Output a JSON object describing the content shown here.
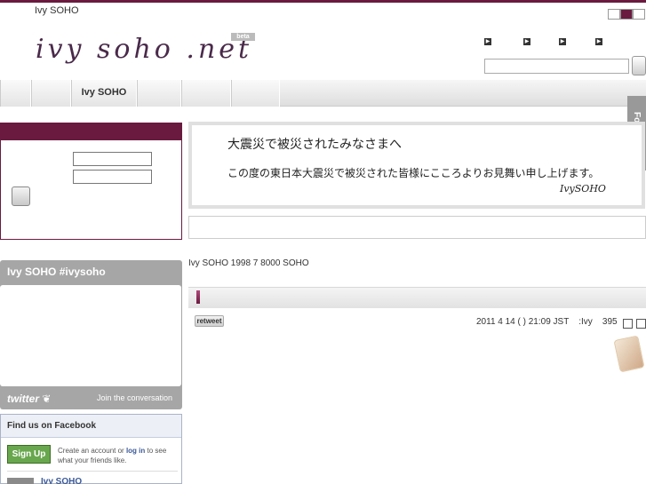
{
  "header": {
    "site_name": "Ivy SOHO",
    "logo_text": "ivy soho .net",
    "beta_badge": "beta"
  },
  "nav": {
    "tabs": [
      "",
      "",
      "Ivy SOHO",
      "",
      "",
      ""
    ]
  },
  "search": {
    "placeholder": "",
    "button_label": ""
  },
  "follow_me": "Follow me",
  "banner": {
    "title": "大震災で被災されたみなさまへ",
    "body": "この度の東日本大震災で被災された皆様にこころよりお見舞い申し上げます。",
    "signature": "IvySOHO"
  },
  "intro_text": "Ivy SOHO  1998 7     8000     SOHO",
  "twitter_widget": {
    "title": "Ivy SOHO #ivysoho",
    "logo": "twitter",
    "join": "Join the conversation"
  },
  "post": {
    "progress": 0.01,
    "retweet_label": "retweet",
    "meta": "2011 4 14 ( ) 21:09 JST    :Ivy    395"
  },
  "facebook": {
    "header": "Find us on Facebook",
    "signup": "Sign Up",
    "text_before": "Create an account or ",
    "login_link": "log in",
    "text_after": " to see what your friends like.",
    "page_name": "Ivy SOHO"
  },
  "colors": {
    "accent": "#6a1a3f",
    "tab_bar": "#e4e4e4",
    "widget_gray": "#a6a6a6",
    "facebook_green": "#69a74e"
  }
}
